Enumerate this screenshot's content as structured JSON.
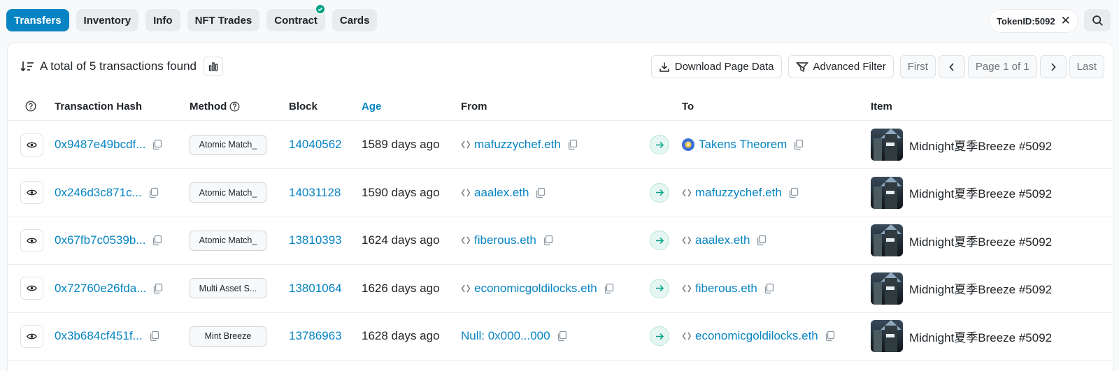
{
  "tabs": [
    {
      "label": "Transfers"
    },
    {
      "label": "Inventory"
    },
    {
      "label": "Info"
    },
    {
      "label": "NFT Trades"
    },
    {
      "label": "Contract"
    },
    {
      "label": "Cards"
    }
  ],
  "filter": {
    "token_label": "TokenID:5092"
  },
  "summary": {
    "text": "A total of 5 transactions found"
  },
  "toolbar": {
    "download_label": "Download Page Data",
    "filter_label": "Advanced Filter",
    "first_label": "First",
    "page_label": "Page 1 of 1",
    "last_label": "Last"
  },
  "columns": {
    "hash": "Transaction Hash",
    "method": "Method",
    "block": "Block",
    "age": "Age",
    "from": "From",
    "to": "To",
    "item": "Item"
  },
  "rows": [
    {
      "hash": "0x9487e49bcdf...",
      "method": "Atomic Match_",
      "block": "14040562",
      "age": "1589 days ago",
      "from": "mafuzzychef.eth",
      "to": "Takens Theorem",
      "item": "Midnight夏季Breeze #5092"
    },
    {
      "hash": "0x246d3c871c...",
      "method": "Atomic Match_",
      "block": "14031128",
      "age": "1590 days ago",
      "from": "aaalex.eth",
      "to": "mafuzzychef.eth",
      "item": "Midnight夏季Breeze #5092"
    },
    {
      "hash": "0x67fb7c0539b...",
      "method": "Atomic Match_",
      "block": "13810393",
      "age": "1624 days ago",
      "from": "fiberous.eth",
      "to": "aaalex.eth",
      "item": "Midnight夏季Breeze #5092"
    },
    {
      "hash": "0x72760e26fda...",
      "method": "Multi Asset S...",
      "block": "13801064",
      "age": "1626 days ago",
      "from": "economicgoldilocks.eth",
      "to": "fiberous.eth",
      "item": "Midnight夏季Breeze #5092"
    },
    {
      "hash": "0x3b684cf451f...",
      "method": "Mint Breeze",
      "block": "13786963",
      "age": "1628 days ago",
      "from": "Null: 0x000...000",
      "to": "economicgoldilocks.eth",
      "item": "Midnight夏季Breeze #5092"
    }
  ],
  "colors": {
    "accent": "#0784c3",
    "success": "#00a186"
  }
}
